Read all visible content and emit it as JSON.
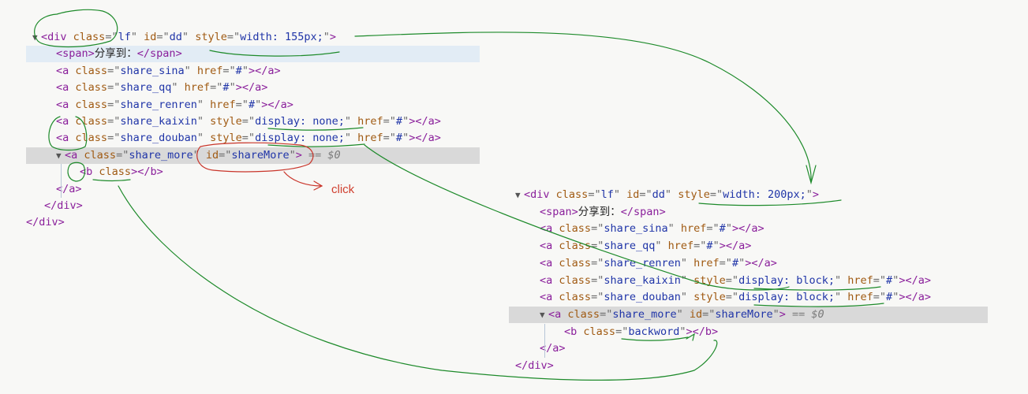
{
  "annotation": {
    "click_label": "click"
  },
  "before": {
    "lines": [
      {
        "kind": "div_open",
        "indent": 0,
        "arrow": "▼",
        "tag": "div",
        "attrs": [
          {
            "name": "class",
            "value": "lf"
          },
          {
            "name": "id",
            "value": "dd"
          },
          {
            "name": "style",
            "value": "width: 155px;"
          }
        ]
      },
      {
        "kind": "span",
        "indent": 1,
        "tag": "span",
        "text": "分享到：",
        "highlight": "blue"
      },
      {
        "kind": "a",
        "indent": 1,
        "tag": "a",
        "attrs": [
          {
            "name": "class",
            "value": "share_sina"
          },
          {
            "name": "href",
            "value": "#"
          }
        ]
      },
      {
        "kind": "a",
        "indent": 1,
        "tag": "a",
        "attrs": [
          {
            "name": "class",
            "value": "share_qq"
          },
          {
            "name": "href",
            "value": "#"
          }
        ]
      },
      {
        "kind": "a",
        "indent": 1,
        "tag": "a",
        "attrs": [
          {
            "name": "class",
            "value": "share_renren"
          },
          {
            "name": "href",
            "value": "#"
          }
        ]
      },
      {
        "kind": "a",
        "indent": 1,
        "tag": "a",
        "attrs": [
          {
            "name": "class",
            "value": "share_kaixin"
          },
          {
            "name": "style",
            "value": "display: none;"
          },
          {
            "name": "href",
            "value": "#"
          }
        ]
      },
      {
        "kind": "a",
        "indent": 1,
        "tag": "a",
        "attrs": [
          {
            "name": "class",
            "value": "share_douban"
          },
          {
            "name": "style",
            "value": "display: none;"
          },
          {
            "name": "href",
            "value": "#"
          }
        ]
      },
      {
        "kind": "a_open",
        "indent": 1,
        "arrow": "▼",
        "tag": "a",
        "attrs": [
          {
            "name": "class",
            "value": "share_more"
          },
          {
            "name": "id",
            "value": "shareMore"
          }
        ],
        "suffix": " == $0",
        "highlight": "gray"
      },
      {
        "kind": "b",
        "indent": 2,
        "tag": "b",
        "attrs": [
          {
            "name": "class",
            "value": null
          }
        ]
      },
      {
        "kind": "close",
        "indent": 1,
        "text": "</a>"
      },
      {
        "kind": "close",
        "indent": 0.5,
        "text": "</div>"
      },
      {
        "kind": "close",
        "indent": -0.5,
        "text": "</div>"
      }
    ]
  },
  "after": {
    "lines": [
      {
        "kind": "div_open",
        "indent": 0,
        "arrow": "▼",
        "tag": "div",
        "attrs": [
          {
            "name": "class",
            "value": "lf"
          },
          {
            "name": "id",
            "value": "dd"
          },
          {
            "name": "style",
            "value": "width: 200px;"
          }
        ]
      },
      {
        "kind": "span",
        "indent": 1,
        "tag": "span",
        "text": "分享到："
      },
      {
        "kind": "a",
        "indent": 1,
        "tag": "a",
        "attrs": [
          {
            "name": "class",
            "value": "share_sina"
          },
          {
            "name": "href",
            "value": "#"
          }
        ]
      },
      {
        "kind": "a",
        "indent": 1,
        "tag": "a",
        "attrs": [
          {
            "name": "class",
            "value": "share_qq"
          },
          {
            "name": "href",
            "value": "#"
          }
        ]
      },
      {
        "kind": "a",
        "indent": 1,
        "tag": "a",
        "attrs": [
          {
            "name": "class",
            "value": "share_renren"
          },
          {
            "name": "href",
            "value": "#"
          }
        ]
      },
      {
        "kind": "a",
        "indent": 1,
        "tag": "a",
        "attrs": [
          {
            "name": "class",
            "value": "share_kaixin"
          },
          {
            "name": "style",
            "value": "display: block;"
          },
          {
            "name": "href",
            "value": "#"
          }
        ]
      },
      {
        "kind": "a",
        "indent": 1,
        "tag": "a",
        "attrs": [
          {
            "name": "class",
            "value": "share_douban"
          },
          {
            "name": "style",
            "value": "display: block;"
          },
          {
            "name": "href",
            "value": "#"
          }
        ]
      },
      {
        "kind": "a_open",
        "indent": 1,
        "arrow": "▼",
        "tag": "a",
        "attrs": [
          {
            "name": "class",
            "value": "share_more"
          },
          {
            "name": "id",
            "value": "shareMore"
          }
        ],
        "suffix": " == $0",
        "highlight": "gray"
      },
      {
        "kind": "b",
        "indent": 2,
        "tag": "b",
        "attrs": [
          {
            "name": "class",
            "value": "backword"
          }
        ]
      },
      {
        "kind": "close",
        "indent": 1,
        "text": "</a>"
      },
      {
        "kind": "close",
        "indent": 0,
        "text": "</div>"
      }
    ]
  }
}
